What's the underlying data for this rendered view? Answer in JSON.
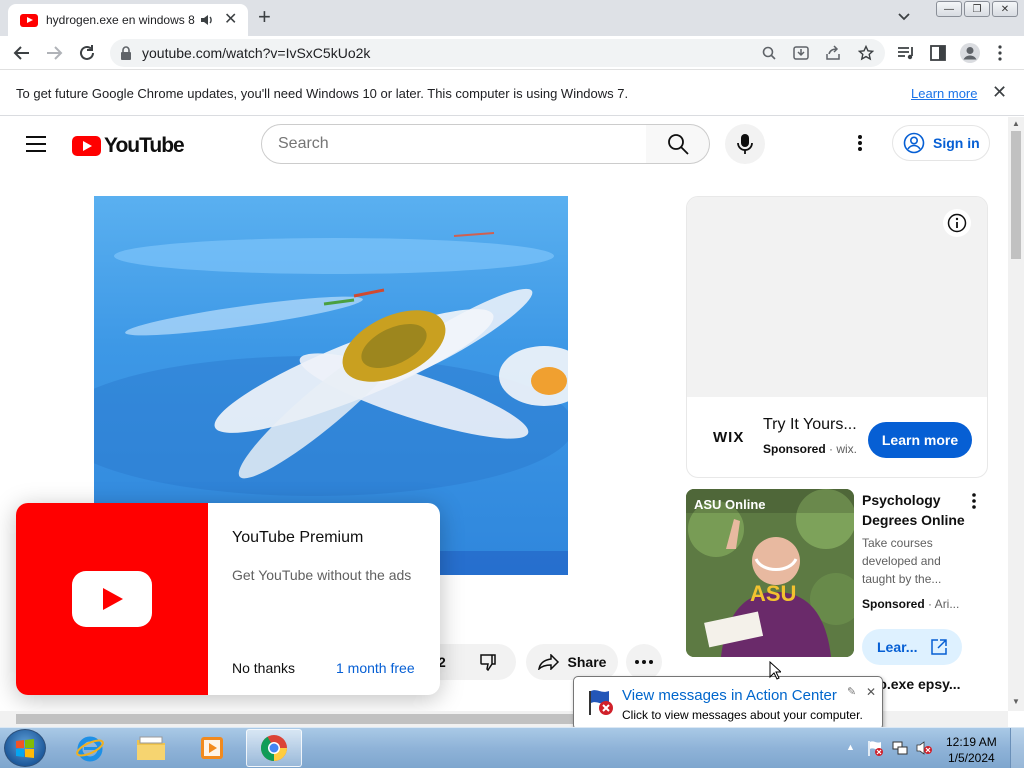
{
  "browser": {
    "tab_title": "hydrogen.exe en windows 8",
    "tab_close": "✕",
    "new_tab": "+",
    "url": "youtube.com/watch?v=IvSxC5kUo2k",
    "window_buttons": [
      "—",
      "❐",
      "✕"
    ]
  },
  "infobar": {
    "message": "To get future Google Chrome updates, you'll need Windows 10 or later. This computer is using Windows 7.",
    "link": "Learn more",
    "close": "✕"
  },
  "youtube": {
    "logo_text": "YouTube",
    "search_placeholder": "Search",
    "sign_in": "Sign in",
    "actions": {
      "like_count_partial": "2",
      "share": "Share"
    },
    "ad": {
      "brand": "WIX",
      "title": "Try It Yours...",
      "sponsored": "Sponsored",
      "advertiser": "· wix.",
      "cta": "Learn more"
    },
    "recommendation": {
      "title": "Psychology Degrees Online",
      "description": "Take courses developed and taught by the...",
      "sponsored": "Sponsored",
      "advertiser": "· Ari...",
      "cta": "Lear...",
      "thumb_brand": "ASU Online",
      "thumb_shirt": "ASU"
    },
    "next_item_title": "...to.exe epsy..."
  },
  "premium_popup": {
    "title": "YouTube Premium",
    "subtitle": "Get YouTube without the ads",
    "dismiss": "No thanks",
    "offer": "1 month free"
  },
  "balloon": {
    "title": "View messages in Action Center",
    "subtitle": "Click to view messages about your computer."
  },
  "taskbar": {
    "time": "12:19 AM",
    "date": "1/5/2024"
  }
}
